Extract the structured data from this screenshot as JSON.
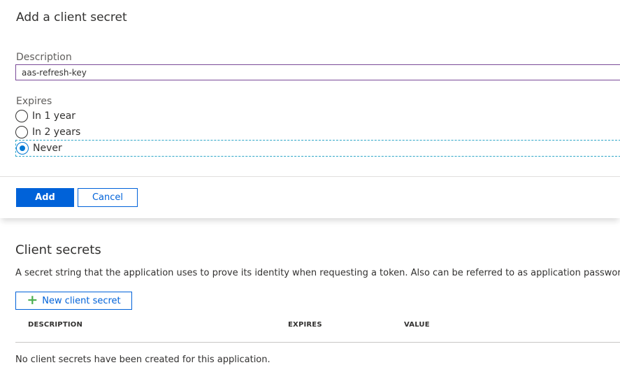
{
  "add_secret": {
    "title": "Add a client secret",
    "description_label": "Description",
    "description_value": "aas-refresh-key",
    "expires_label": "Expires",
    "options": [
      "In 1 year",
      "In 2 years",
      "Never"
    ],
    "selected_option": "Never",
    "add_label": "Add",
    "cancel_label": "Cancel"
  },
  "client_secrets": {
    "title": "Client secrets",
    "description": "A secret string that the application uses to prove its identity when requesting a token. Also can be referred to as application password.",
    "new_button_label": "New client secret",
    "new_button_icon": "plus-icon",
    "columns": [
      "DESCRIPTION",
      "EXPIRES",
      "VALUE"
    ],
    "empty_message": "No client secrets have been created for this application."
  },
  "colors": {
    "accent": "#0062d9",
    "radio_selected": "#0078d4",
    "input_border": "#7a4a98",
    "plus_icon": "#4caf50"
  }
}
